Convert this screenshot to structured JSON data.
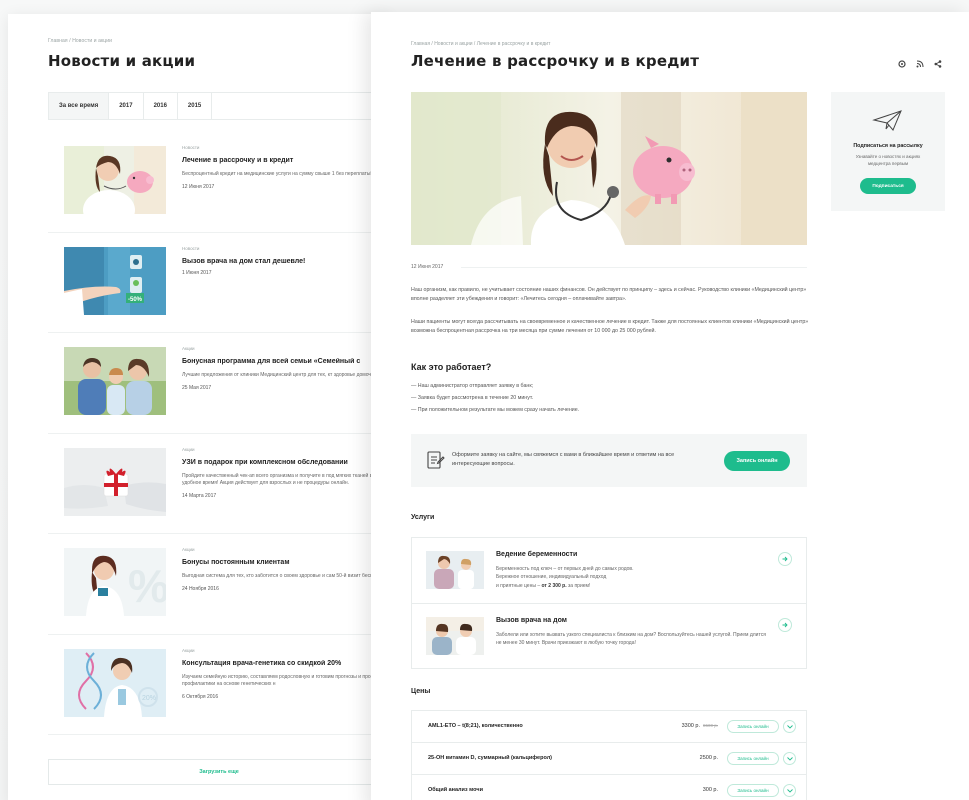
{
  "accent_color": "#1ebc8d",
  "left": {
    "breadcrumb": "Главная / Новости и акции",
    "title": "Новости и акции",
    "year_tabs": [
      "За все время",
      "2017",
      "2016",
      "2015"
    ],
    "active_tab": "За все время",
    "news": [
      {
        "category": "Новости",
        "title": "Лечение в рассрочку и в кредит",
        "desc": "Беспроцентный кредит на медицинские услуги на сумму свыше 1 без переплаты!",
        "date": "12 Июня 2017"
      },
      {
        "category": "Новости",
        "title": "Вызов врача на дом стал дешевле!",
        "desc": "",
        "date": "1 Июня 2017"
      },
      {
        "category": "Акции",
        "title": "Бонусная программа для всей семьи «Семейный с",
        "desc": "Лучшие предложения от клиники Медицинский центр для тех, кт здоровье домочадцев!",
        "date": "25 Мая 2017"
      },
      {
        "category": "Акции",
        "title": "УЗИ в подарок при комплексном обследовании",
        "desc": "Пройдите качественный чек-ап всего организма и получите в под мягких тканей в удобное время! Акция действует для взрослых и не процедуры онлайн.",
        "date": "14 Марта 2017"
      },
      {
        "category": "Акции",
        "title": "Бонусы постоянным клиентам",
        "desc": "Выгодная система для тех, кто заботится о своем здоровье и сам 50-й визит бесплатно!",
        "date": "24 Ноября 2016"
      },
      {
        "category": "Акции",
        "title": "Консультация врача-генетика со скидкой 20%",
        "desc": "Изучаем семейную историю, составляем родословную и готовим прогнозы и программы профилактики на основе генетических н",
        "date": "6 Октября 2016"
      }
    ],
    "load_more_label": "Загрузить еще"
  },
  "article": {
    "breadcrumb": "Главная / Новости и акции / Лечение в рассрочку и в кредит",
    "title": "Лечение в рассрочку и в кредит",
    "tools": [
      "print-icon",
      "rss-icon",
      "share-icon"
    ],
    "date": "12 Июня 2017",
    "paragraph_1": "Наш организм, как правило, не учитывает состояние наших финансов. Он действует по принципу – здесь и сейчас. Руководство клиники «Медицинский центр» вполне разделяет эти убеждения и говорит: «Лечитесь сегодня – оплачивайте завтра».",
    "paragraph_2": "Наши пациенты могут всегда рассчитывать на своевременное и качественное лечение в кредит. Также для постоянных клиентов клиники «Медицинский центр» возможна беспроцентная рассрочка на три месяца при сумме лечения от 10 000 до 25 000 рублей.",
    "how_title": "Как это работает?",
    "how_steps": [
      "— Наш администратор отправляет заявку в банк;",
      "— Заявка будет рассмотрена в течение 20 минут.",
      "— При положительном результате мы можем сразу начать лечение."
    ],
    "cta_text": "Оформите заявку на сайте, мы свяжемся с вами в ближайшее время и ответим на все интересующие вопросы.",
    "cta_button": "Запись онлайн",
    "services_title": "Услуги",
    "services": [
      {
        "title": "Ведение беременности",
        "desc_1": "Беременность под ключ – от первых дней до самых родов.",
        "desc_2": "Бережное отношение, индивидуальный подход",
        "desc_3_prefix": "и приятные цены –",
        "desc_3_bold": "от 2 300 р.",
        "desc_3_suffix": "за прием!"
      },
      {
        "title": "Вызов врача на дом",
        "desc": "Заболели или хотите вызвать узкого специалиста к близким на дом? Воспользуйтесь нашей услугой. Прием длится не менее 30 минут. Врачи приезжают в любую точку города!"
      }
    ],
    "prices_title": "Цены",
    "prices": [
      {
        "name": "AML1-ETO – t(8;21), количественно",
        "price": "3300 р.",
        "old_price": "8600 р.",
        "button": "Запись онлайн"
      },
      {
        "name": "25-OH витамин D, суммарный (кальциферол)",
        "price": "2500 р.",
        "old_price": "",
        "button": "Запись онлайн"
      },
      {
        "name": "Общий анализ мочи",
        "price": "300 р.",
        "old_price": "",
        "button": "Запись онлайн"
      }
    ]
  },
  "subscribe": {
    "title": "Подписаться на рассылку",
    "desc": "Узнавайте о новостях и акциях медцентра первым",
    "button": "Подписаться"
  }
}
